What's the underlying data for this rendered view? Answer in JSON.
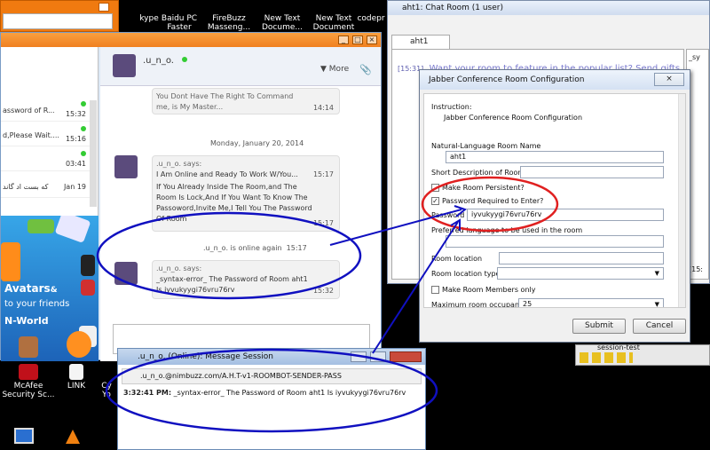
{
  "desktop": {
    "top_icons": [
      {
        "label": "kype"
      },
      {
        "label": "Baidu PC Faster"
      },
      {
        "label": "FireBuzz Masseng..."
      },
      {
        "label": "New Text Docume..."
      },
      {
        "label": "New Text Document"
      },
      {
        "label": "codepr"
      }
    ],
    "bottom_icons": [
      {
        "label": "McAfee Security Sc..."
      },
      {
        "label": "LINK"
      },
      {
        "label": "Cy Yo"
      }
    ]
  },
  "chat_window": {
    "title_minimize": "_",
    "title_maximize": "□",
    "title_close": "×",
    "contacts": [
      {
        "text": "assword of R...",
        "time": "15:32"
      },
      {
        "text": "d,Please Wait....",
        "time": "15:16"
      },
      {
        "text": "",
        "time": "03:41"
      },
      {
        "text": "ﮐﻪ ﺑﺴﺖ ﺍﺩ ﮔﺎﻧﺪ",
        "time": "Jan 19"
      }
    ],
    "ad": {
      "headline": "Avatars",
      "amp": "&",
      "line2": "to your friends",
      "brand": "N-World"
    },
    "header": {
      "name": ".u_n_o.",
      "more": "More"
    },
    "messages": {
      "prev_text": "You Dont Have The Right To Command me, is My Master...",
      "prev_time": "14:14",
      "date_separator": "Monday, January 20, 2014",
      "m1_sender": ".u_n_o. says:",
      "m1_line1": "I Am Online and Ready To Work W/You...",
      "m1_time1": "15:17",
      "m1_line2": "If You Already Inside The Room,and The Room Is Lock,And If You Want To Know The Passoword,Invite Me,I Tell You The Password Of Room",
      "m1_time2": "15:17",
      "online_again": ".u_n_o. is online again",
      "online_time": "15:17",
      "m2_sender": ".u_n_o. says:",
      "m2_line1": "_syntax-error_ The Password of Room aht1",
      "m2_line2": "Is iyvukyygi76vru76rv",
      "m2_time": "15:32"
    }
  },
  "message_session": {
    "title": ".u_n_o. (Online): Message Session",
    "address": ".u_n_o.@nimbuzz.com/A.H.T-v1-ROOMBOT-SENDER-PASS",
    "timestamp": "3:32:41 PM:",
    "line": "_syntax-error_ The Password of Room aht1  Is  iyvukyygi76vru76rv"
  },
  "room_window": {
    "title": "aht1: Chat Room (1 user)",
    "tab": "aht1",
    "ad_ts": "[15:31]",
    "ad_text": "Want your room to feature in the popular list? Send gifts",
    "side_text": "_sy",
    "side_ts": "[15:"
  },
  "jabber_dialog": {
    "title": "Jabber Conference Room Configuration",
    "close": "×",
    "instruction_label": "Instruction:",
    "instruction_text": "Jabber Conference Room Configuration",
    "nl_room_name_label": "Natural-Language Room Name",
    "nl_room_name_value": "aht1",
    "short_desc_label": "Short Description of Room",
    "short_desc_value": "",
    "persistent_label": "Make Room Persistent?",
    "persistent_checked": false,
    "password_required_label": "Password Required to Enter?",
    "password_required_checked": true,
    "password_label": "Password",
    "password_value": "iyvukyygi76vru76rv",
    "language_label": "Preferred language to be used in the room",
    "room_location_label": "Room location",
    "room_location_type_label": "Room location type",
    "members_only_label": "Make Room Members only",
    "max_occupants_label": "Maximum room occupants",
    "max_occupants_value": "25",
    "submit": "Submit",
    "cancel": "Cancel"
  },
  "bottom_right": {
    "label": "session-test"
  },
  "annotations": {
    "color": "#1010c0",
    "highlight_color": "#e02020"
  }
}
